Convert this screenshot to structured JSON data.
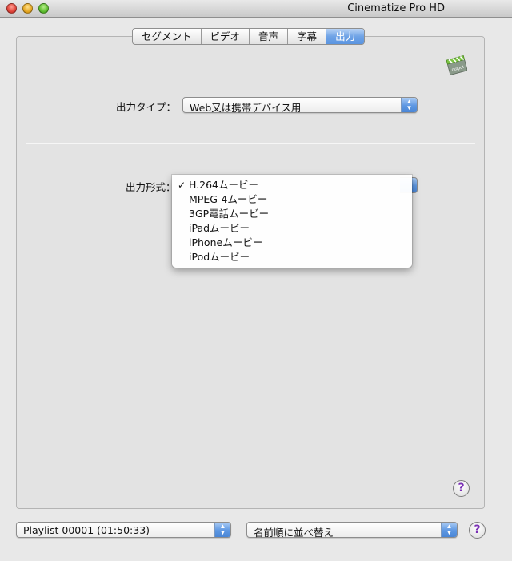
{
  "window": {
    "title": "Cinematize Pro HD",
    "controls": [
      "close",
      "minimize",
      "zoom"
    ]
  },
  "tabs": [
    {
      "label": "セグメント",
      "active": false
    },
    {
      "label": "ビデオ",
      "active": false
    },
    {
      "label": "音声",
      "active": false
    },
    {
      "label": "字幕",
      "active": false
    },
    {
      "label": "出力",
      "active": true
    }
  ],
  "output_icon": {
    "name": "output-clapper-icon",
    "text": "output"
  },
  "output_type": {
    "label": "出力タイプ：",
    "value": "Web又は携帯デバイス用"
  },
  "output_format": {
    "label": "出力形式：",
    "menu": {
      "check": "✓",
      "options": [
        "H.264ムービー",
        "MPEG-4ムービー",
        "3GP電話ムービー",
        "iPadムービー",
        "iPhoneムービー",
        "iPodムービー"
      ],
      "selected": "H.264ムービー"
    }
  },
  "help": {
    "glyph": "?"
  },
  "bottom": {
    "playlist_value": "Playlist 00001 (01:50:33)",
    "sort_value": "名前順に並べ替え"
  },
  "colors": {
    "accent": "#5b95e1",
    "help_glyph": "#7a2fb5",
    "panel": "#e3e3e3"
  }
}
